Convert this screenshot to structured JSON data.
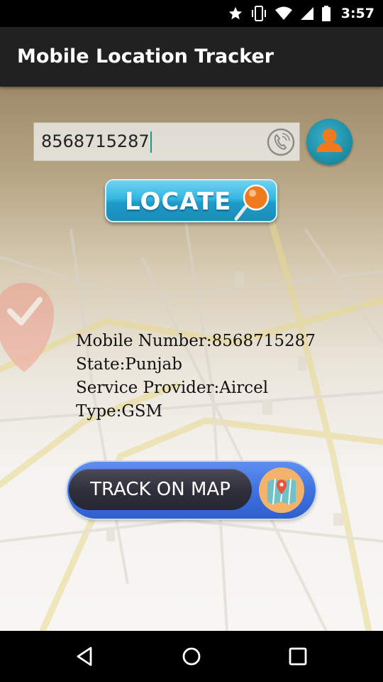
{
  "status_bar": {
    "time": "3:57",
    "icons": [
      "star-icon",
      "vibrate-icon",
      "wifi-icon",
      "signal-icon",
      "battery-icon"
    ]
  },
  "toolbar": {
    "title": "Mobile Location Tracker",
    "background": "#212121"
  },
  "search": {
    "value": "8568715287",
    "call_icon": "phone-call-icon",
    "contact_icon": "contact-person-icon"
  },
  "locate_button": {
    "label": "LOCATE",
    "icon": "map-pin-icon"
  },
  "result": {
    "mobile_line": "Mobile Number:8568715287",
    "state_line": "State:Punjab",
    "provider_line": "Service Provider:Aircel",
    "type_line": "Type:GSM"
  },
  "track_button": {
    "label": "TRACK ON MAP",
    "icon": "folded-map-icon"
  },
  "nav_bar": {
    "buttons": [
      "back-icon",
      "home-icon",
      "recents-icon"
    ]
  },
  "colors": {
    "accent": "#1e9a8a",
    "locate_blue": "#35b7e2",
    "track_blue": "#3f73e0",
    "contact_teal": "#1a8aa3",
    "avatar_orange": "#f07a1e"
  }
}
